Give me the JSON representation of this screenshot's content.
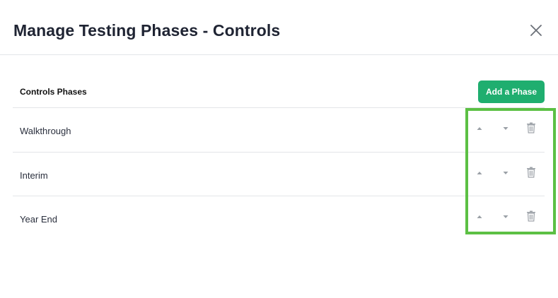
{
  "modal": {
    "title": "Manage Testing Phases - Controls",
    "close_icon": "close-icon"
  },
  "section": {
    "title": "Controls Phases",
    "add_button_label": "Add a Phase",
    "add_button_color": "#1fae6f"
  },
  "phases": [
    {
      "name": "Walkthrough"
    },
    {
      "name": "Interim"
    },
    {
      "name": "Year End"
    }
  ],
  "row_action_icons": [
    "caret-up-icon",
    "caret-down-icon",
    "trash-icon"
  ],
  "colors": {
    "highlight": "#5cc044",
    "divider": "#e3e5e8",
    "icon": "#9aa0a6"
  }
}
